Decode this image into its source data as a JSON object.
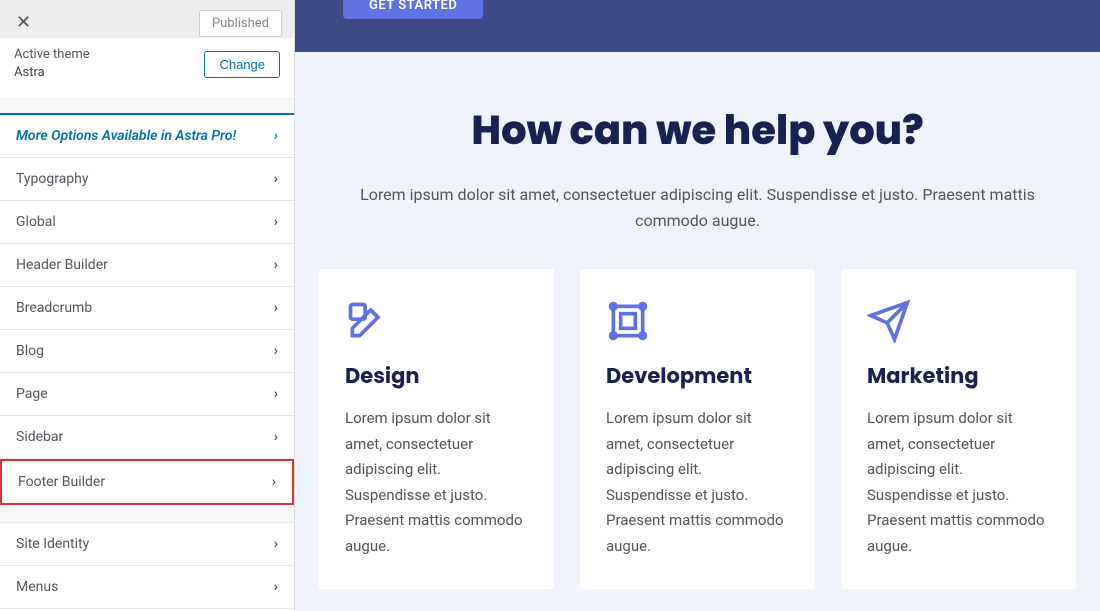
{
  "sidebar": {
    "published_label": "Published",
    "active_theme_label": "Active theme",
    "active_theme_name": "Astra",
    "change_label": "Change",
    "promo_text": "More Options Available in Astra Pro!",
    "menu": [
      {
        "label": "Typography"
      },
      {
        "label": "Global"
      },
      {
        "label": "Header Builder"
      },
      {
        "label": "Breadcrumb"
      },
      {
        "label": "Blog"
      },
      {
        "label": "Page"
      },
      {
        "label": "Sidebar"
      },
      {
        "label": "Footer Builder"
      }
    ],
    "menu2": [
      {
        "label": "Site Identity"
      },
      {
        "label": "Menus"
      }
    ]
  },
  "preview": {
    "cta_label": "GET STARTED",
    "help_title": "How can we help you?",
    "help_desc": "Lorem ipsum dolor sit amet, consectetuer adipiscing elit. Suspendisse et justo. Praesent mattis commodo augue.",
    "cards": [
      {
        "title": "Design",
        "desc": "Lorem ipsum dolor sit amet, consectetuer adipiscing elit. Suspendisse et justo. Praesent mattis commodo augue."
      },
      {
        "title": "Development",
        "desc": "Lorem ipsum dolor sit amet, consectetuer adipiscing elit. Suspendisse et justo. Praesent mattis commodo augue."
      },
      {
        "title": "Marketing",
        "desc": "Lorem ipsum dolor sit amet, consectetuer adipiscing elit. Suspendisse et justo. Praesent mattis commodo augue."
      }
    ]
  }
}
